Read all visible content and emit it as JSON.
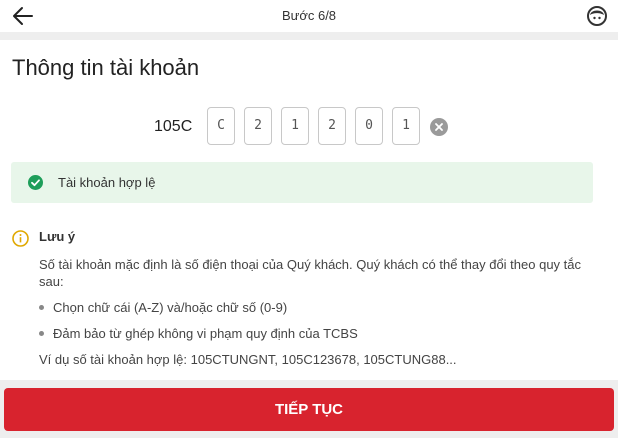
{
  "header": {
    "step_label": "Bước 6/8",
    "back_icon": "arrow-left-icon",
    "support_icon": "support-agent-icon"
  },
  "page": {
    "title": "Thông tin tài khoản"
  },
  "account": {
    "prefix": "105C",
    "digits": [
      "C",
      "2",
      "1",
      "2",
      "0",
      "1"
    ],
    "clear_icon": "clear-circle-icon"
  },
  "validation": {
    "icon": "check-circle-icon",
    "message": "Tài khoản hợp lệ",
    "color": "#1e9e5a",
    "background": "#e8f6ea"
  },
  "note": {
    "icon": "info-circle-icon",
    "title": "Lưu ý",
    "body": "Số tài khoản mặc định là số điện thoại của Quý khách. Quý khách có thể thay đổi theo quy tắc sau:",
    "rules": [
      "Chọn chữ cái (A-Z) và/hoặc chữ số (0-9)",
      "Đảm bảo từ ghép không vi phạm quy định của TCBS"
    ],
    "example": "Ví dụ số tài khoản hợp lệ: 105CTUNGNT, 105C123678, 105CTUNG88..."
  },
  "cta": {
    "label": "TIẾP TỤC",
    "color": "#d8232e"
  }
}
